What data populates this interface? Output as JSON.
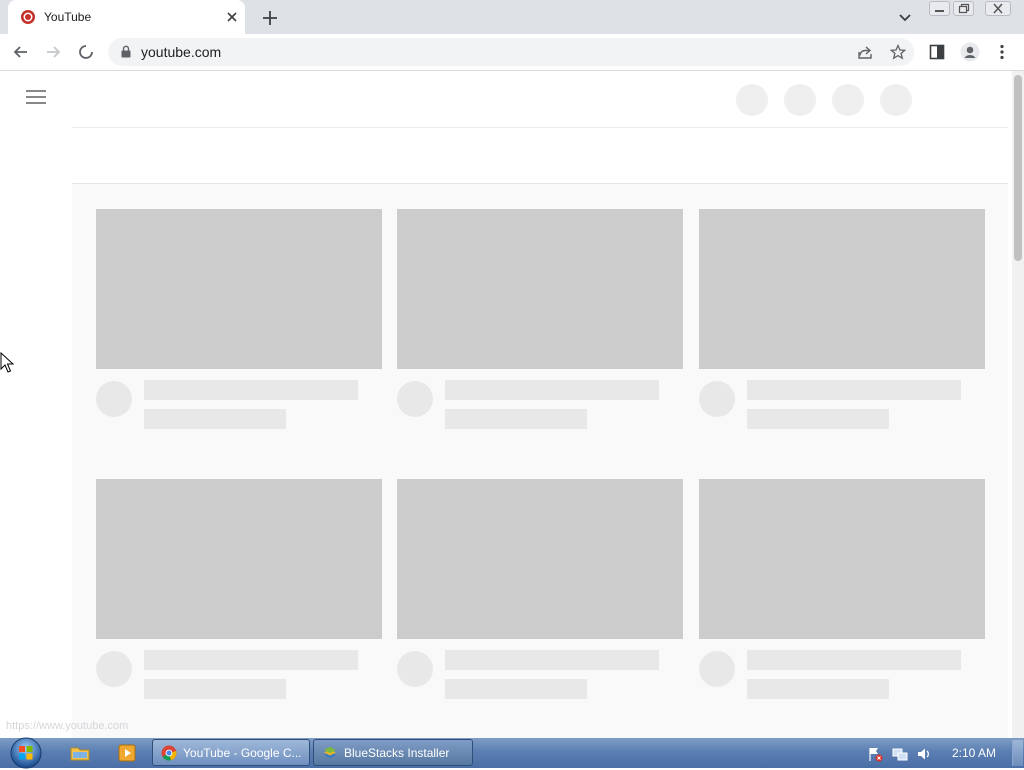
{
  "browser": {
    "tab": {
      "title": "YouTube"
    },
    "omnibox": {
      "url": "youtube.com"
    },
    "status_url": "https://www.youtube.com"
  },
  "page": {
    "skeleton_rows": 2,
    "skeleton_columns": 3
  },
  "taskbar": {
    "tasks": [
      {
        "label": "YouTube - Google C...",
        "icon": "chrome-icon"
      },
      {
        "label": "BlueStacks Installer",
        "icon": "bluestacks-icon"
      }
    ],
    "clock": "2:10 AM"
  },
  "colors": {
    "skeleton_thumb": "#cccccc",
    "skeleton_line": "#e8e8e8",
    "taskbar": "#5b7fb2",
    "tab_strip": "#dee1e6"
  }
}
